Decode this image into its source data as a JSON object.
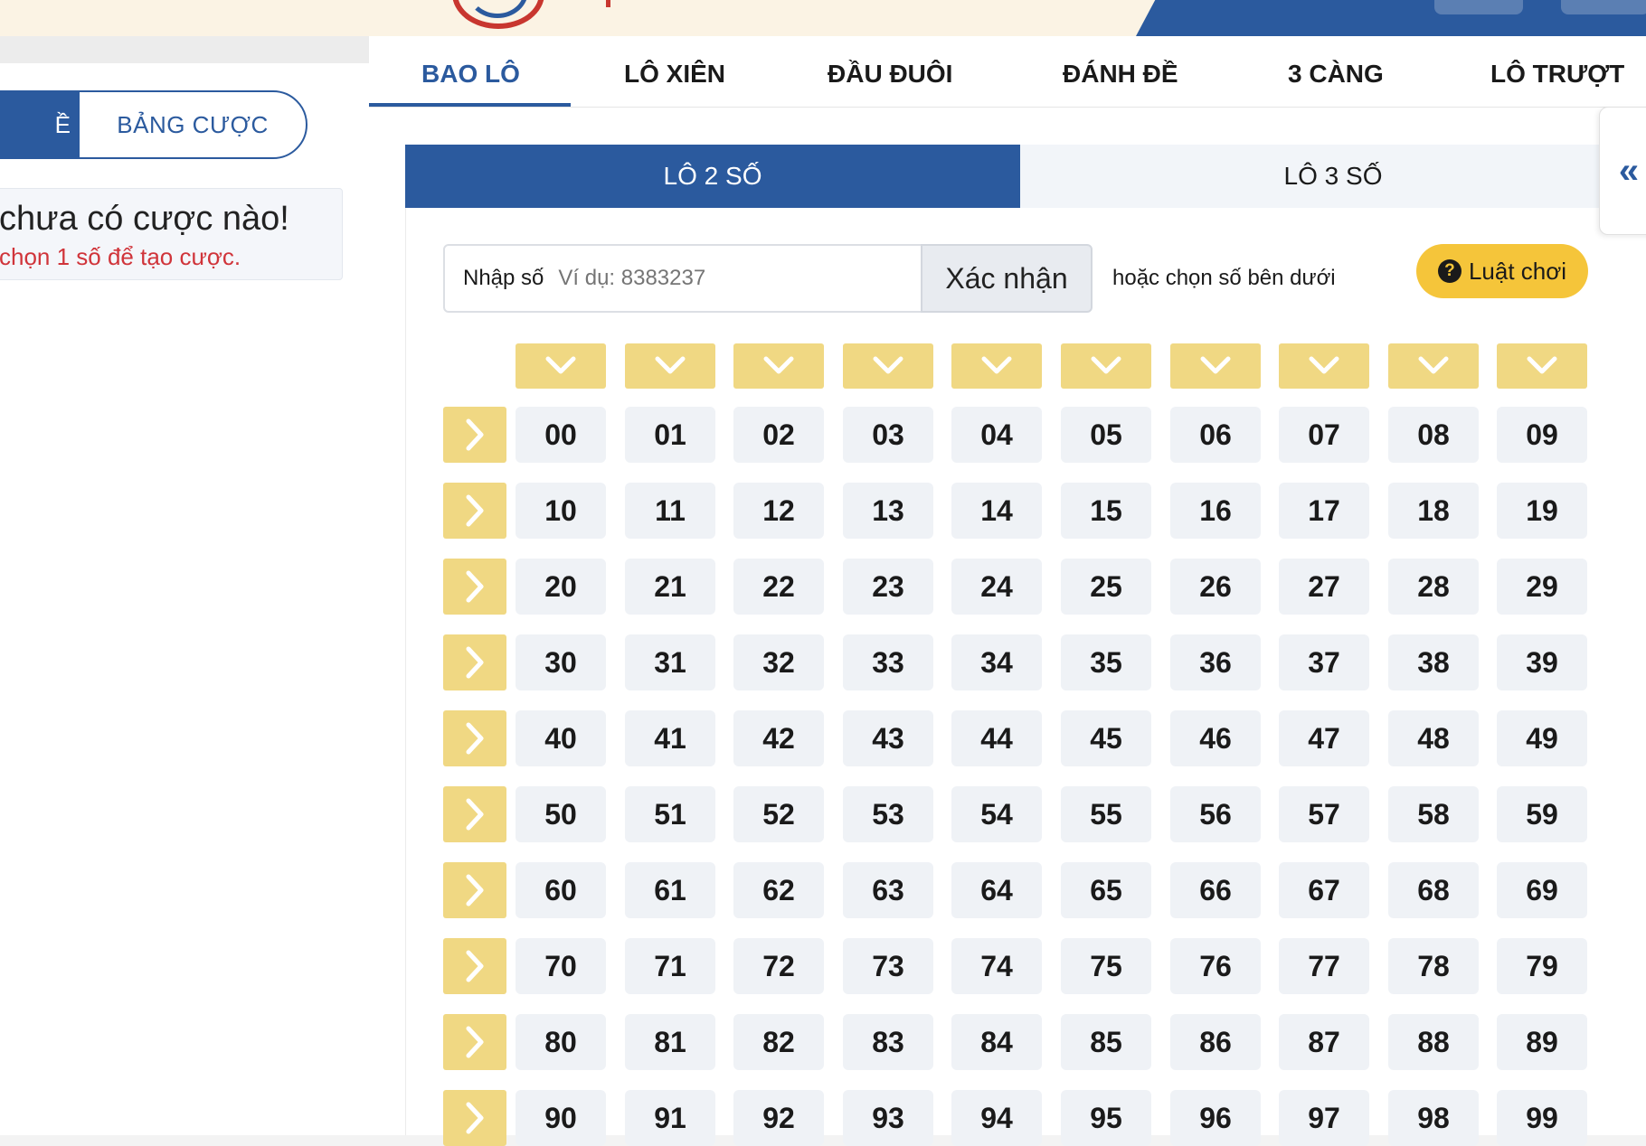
{
  "colors": {
    "primary": "#2b5a9e",
    "accent_yellow": "#f0d883",
    "rules_yellow": "#f5c53a",
    "error_red": "#d0343a"
  },
  "left_panel": {
    "active_tab_label": "Ề",
    "bet_board_label": "BẢNG CƯỢC",
    "empty_title": "chưa có cược nào!",
    "empty_subtitle": "chọn 1 số để tạo cược."
  },
  "game_tabs": [
    {
      "label": "BAO LÔ",
      "active": true
    },
    {
      "label": "LÔ XIÊN",
      "active": false
    },
    {
      "label": "ĐẦU ĐUÔI",
      "active": false
    },
    {
      "label": "ĐÁNH ĐỀ",
      "active": false
    },
    {
      "label": "3 CÀNG",
      "active": false
    },
    {
      "label": "LÔ TRƯỢT",
      "active": false
    }
  ],
  "sub_tabs": [
    {
      "label": "LÔ 2 SỐ",
      "active": true
    },
    {
      "label": "LÔ 3 SỐ",
      "active": false
    }
  ],
  "input": {
    "label": "Nhập số",
    "placeholder": "Ví dụ: 8383237",
    "confirm_label": "Xác nhận",
    "or_text": "hoặc chọn số bên dưới",
    "rules_label": "Luật chơi"
  },
  "icons": {
    "column_select": "chevron-down-icon",
    "row_select": "chevron-right-icon",
    "rules": "question-circle-icon",
    "side_toggle": "double-chevron-left-icon"
  },
  "side_toggle_glyph": "«",
  "grid": {
    "rows": [
      [
        "00",
        "01",
        "02",
        "03",
        "04",
        "05",
        "06",
        "07",
        "08",
        "09"
      ],
      [
        "10",
        "11",
        "12",
        "13",
        "14",
        "15",
        "16",
        "17",
        "18",
        "19"
      ],
      [
        "20",
        "21",
        "22",
        "23",
        "24",
        "25",
        "26",
        "27",
        "28",
        "29"
      ],
      [
        "30",
        "31",
        "32",
        "33",
        "34",
        "35",
        "36",
        "37",
        "38",
        "39"
      ],
      [
        "40",
        "41",
        "42",
        "43",
        "44",
        "45",
        "46",
        "47",
        "48",
        "49"
      ],
      [
        "50",
        "51",
        "52",
        "53",
        "54",
        "55",
        "56",
        "57",
        "58",
        "59"
      ],
      [
        "60",
        "61",
        "62",
        "63",
        "64",
        "65",
        "66",
        "67",
        "68",
        "69"
      ],
      [
        "70",
        "71",
        "72",
        "73",
        "74",
        "75",
        "76",
        "77",
        "78",
        "79"
      ],
      [
        "80",
        "81",
        "82",
        "83",
        "84",
        "85",
        "86",
        "87",
        "88",
        "89"
      ],
      [
        "90",
        "91",
        "92",
        "93",
        "94",
        "95",
        "96",
        "97",
        "98",
        "99"
      ]
    ]
  }
}
